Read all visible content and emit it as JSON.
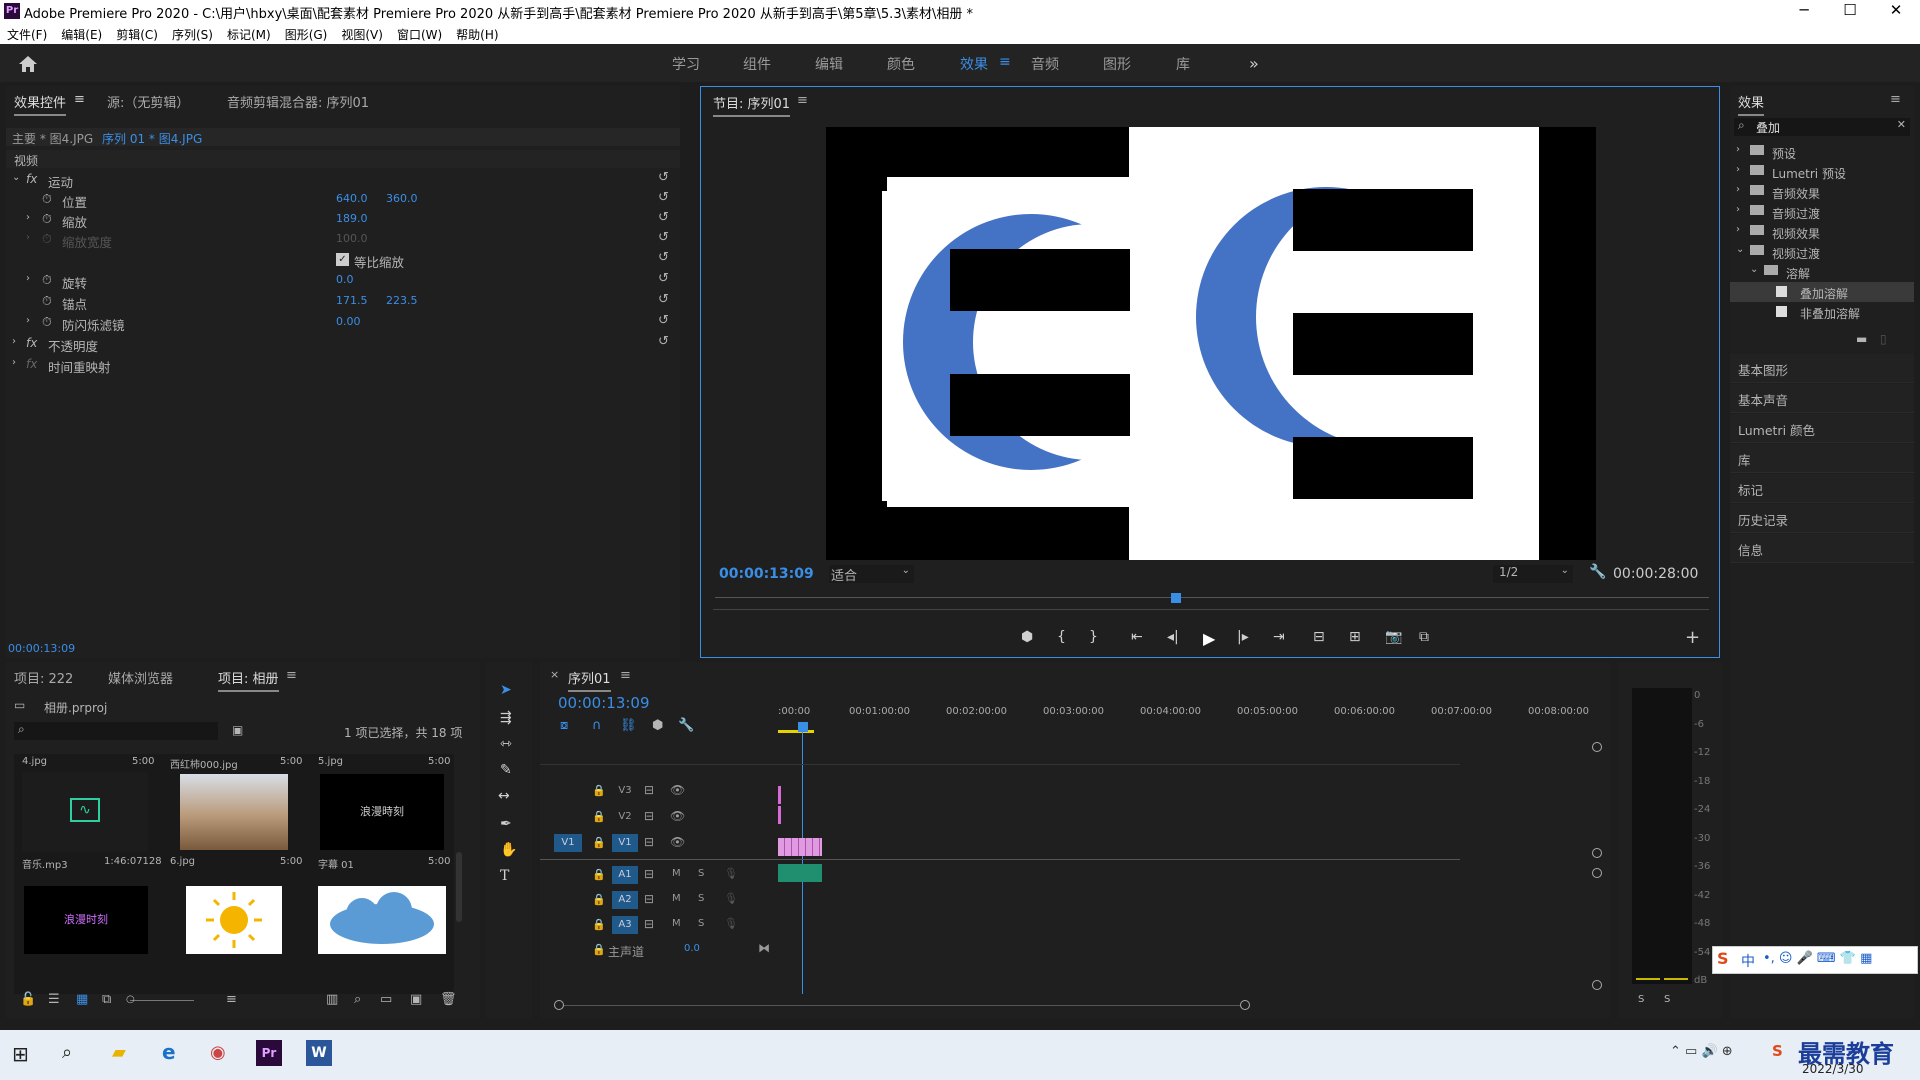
{
  "window": {
    "title": "Adobe Premiere Pro 2020 - C:\\用户\\hbxy\\桌面\\配套素材 Premiere Pro 2020 从新手到高手\\配套素材 Premiere Pro 2020 从新手到高手\\第5章\\5.3\\素材\\相册 *",
    "minimize": "─",
    "maximize": "☐",
    "close": "✕"
  },
  "menu": [
    "文件(F)",
    "编辑(E)",
    "剪辑(C)",
    "序列(S)",
    "标记(M)",
    "图形(G)",
    "视图(V)",
    "窗口(W)",
    "帮助(H)"
  ],
  "workspaces": [
    "学习",
    "组件",
    "编辑",
    "颜色",
    "效果",
    "音频",
    "图形",
    "库"
  ],
  "workspace_menu_icon": "≡",
  "workspace_more": "»",
  "effect_controls": {
    "tabs": [
      "效果控件",
      "源:（无剪辑）",
      "音频剪辑混合器: 序列01"
    ],
    "tab_menu": "≡",
    "master": "主要 * 图4.JPG",
    "seq": "序列 01 * 图4.JPG",
    "video": "视频",
    "props": {
      "motion": "运动",
      "position": "位置",
      "position_x": "640.0",
      "position_y": "360.0",
      "scale": "缩放",
      "scale_v": "189.0",
      "scale_width": "缩放宽度",
      "scale_width_v": "100.0",
      "uniform": "等比缩放",
      "rotation": "旋转",
      "rotation_v": "0.0",
      "anchor": "锚点",
      "anchor_x": "171.5",
      "anchor_y": "223.5",
      "flicker": "防闪烁滤镜",
      "flicker_v": "0.00",
      "opacity": "不透明度",
      "timeremap": "时间重映射"
    },
    "timecode": "00:00:13:09"
  },
  "program": {
    "title": "节目: 序列01",
    "menu": "≡",
    "timecode": "00:00:13:09",
    "fit": "适合",
    "resolution": "1/2",
    "duration": "00:00:28:00",
    "add": "+"
  },
  "effects": {
    "title": "效果",
    "menu": "≡",
    "search": "叠加",
    "tree": [
      {
        "label": "预设",
        "level": 0,
        "open": false
      },
      {
        "label": "Lumetri 预设",
        "level": 0,
        "open": false
      },
      {
        "label": "音频效果",
        "level": 0,
        "open": false
      },
      {
        "label": "音频过渡",
        "level": 0,
        "open": false
      },
      {
        "label": "视频效果",
        "level": 0,
        "open": false
      },
      {
        "label": "视频过渡",
        "level": 0,
        "open": true
      },
      {
        "label": "溶解",
        "level": 1,
        "open": true
      },
      {
        "label": "叠加溶解",
        "level": 2,
        "selected": true
      },
      {
        "label": "非叠加溶解",
        "level": 2,
        "selected": false
      }
    ],
    "panels": [
      "基本图形",
      "基本声音",
      "Lumetri 颜色",
      "库",
      "标记",
      "历史记录",
      "信息"
    ]
  },
  "project": {
    "tabs": [
      "项目: 222",
      "媒体浏览器",
      "项目: 相册"
    ],
    "file": "相册.prproj",
    "selection": "1 项已选择，共 18 项",
    "items": [
      {
        "name": "4.jpg",
        "dur": "5:00",
        "label": "音乐.mp3",
        "label_dur": "1:46:07128"
      },
      {
        "name": "西红柿000.jpg",
        "dur": "5:00",
        "label": "6.jpg",
        "label_dur": "5:00"
      },
      {
        "name": "5.jpg",
        "dur": "5:00",
        "label": "字幕 01",
        "label_dur": "5:00",
        "thumb_text": "浪漫時刻"
      },
      {
        "thumb_text": "浪漫时刻"
      },
      {},
      {}
    ]
  },
  "timeline": {
    "tab": "序列01",
    "menu": "≡",
    "close": "×",
    "timecode": "00:00:13:09",
    "ruler": [
      ":00:00",
      "00:01:00:00",
      "00:02:00:00",
      "00:03:00:00",
      "00:04:00:00",
      "00:05:00:00",
      "00:06:00:00",
      "00:07:00:00",
      "00:08:00:00"
    ],
    "video_tracks": [
      "V3",
      "V2",
      "V1"
    ],
    "audio_tracks": [
      "A1",
      "A2",
      "A3"
    ],
    "source_v": "V1",
    "mute": "M",
    "solo": "S",
    "master": "主声道",
    "master_v": "0.0"
  },
  "meter": {
    "scale": [
      "0",
      "-6",
      "-12",
      "-18",
      "-24",
      "-30",
      "-36",
      "-42",
      "-48",
      "-54",
      "dB"
    ],
    "solo": "S"
  },
  "taskbar": {
    "date": "2022/3/30",
    "watermark": "最需教育",
    "ime": "中"
  }
}
